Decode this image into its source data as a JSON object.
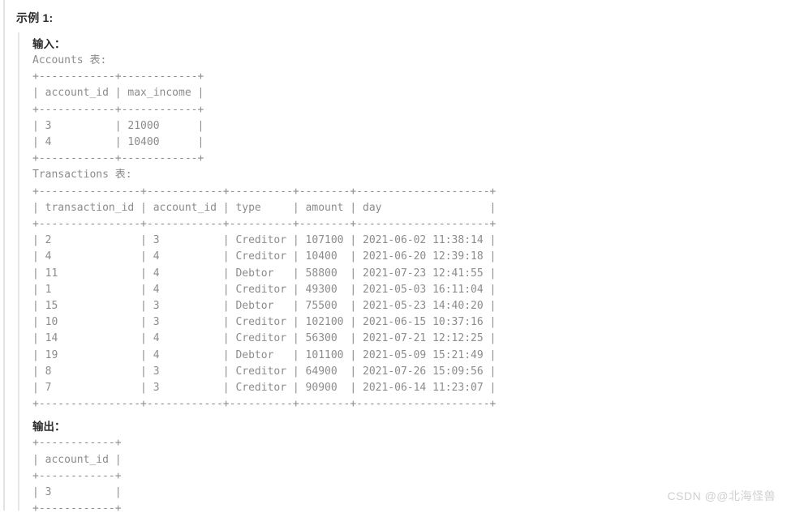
{
  "example": {
    "heading": "示例 1:"
  },
  "input": {
    "label": "输入：",
    "accounts_caption": "Accounts 表:",
    "accounts_table": "+------------+------------+\n| account_id | max_income |\n+------------+------------+\n| 3          | 21000      |\n| 4          | 10400      |\n+------------+------------+",
    "transactions_caption": "Transactions 表:",
    "transactions_table": "+----------------+------------+----------+--------+---------------------+\n| transaction_id | account_id | type     | amount | day                 |\n+----------------+------------+----------+--------+---------------------+\n| 2              | 3          | Creditor | 107100 | 2021-06-02 11:38:14 |\n| 4              | 4          | Creditor | 10400  | 2021-06-20 12:39:18 |\n| 11             | 4          | Debtor   | 58800  | 2021-07-23 12:41:55 |\n| 1              | 4          | Creditor | 49300  | 2021-05-03 16:11:04 |\n| 15             | 3          | Debtor   | 75500  | 2021-05-23 14:40:20 |\n| 10             | 3          | Creditor | 102100 | 2021-06-15 10:37:16 |\n| 14             | 4          | Creditor | 56300  | 2021-07-21 12:12:25 |\n| 19             | 4          | Debtor   | 101100 | 2021-05-09 15:21:49 |\n| 8              | 3          | Creditor | 64900  | 2021-07-26 15:09:56 |\n| 7              | 3          | Creditor | 90900  | 2021-06-14 11:23:07 |\n+----------------+------------+----------+--------+---------------------+"
  },
  "output": {
    "label": "输出：",
    "table": "+------------+\n| account_id |\n+------------+\n| 3          |\n+------------+"
  },
  "watermark": {
    "text": "CSDN @@北海怪兽"
  },
  "tables": {
    "accounts": {
      "columns": [
        "account_id",
        "max_income"
      ],
      "rows": [
        [
          "3",
          "21000"
        ],
        [
          "4",
          "10400"
        ]
      ]
    },
    "transactions": {
      "columns": [
        "transaction_id",
        "account_id",
        "type",
        "amount",
        "day"
      ],
      "rows": [
        [
          "2",
          "3",
          "Creditor",
          "107100",
          "2021-06-02 11:38:14"
        ],
        [
          "4",
          "4",
          "Creditor",
          "10400",
          "2021-06-20 12:39:18"
        ],
        [
          "11",
          "4",
          "Debtor",
          "58800",
          "2021-07-23 12:41:55"
        ],
        [
          "1",
          "4",
          "Creditor",
          "49300",
          "2021-05-03 16:11:04"
        ],
        [
          "15",
          "3",
          "Debtor",
          "75500",
          "2021-05-23 14:40:20"
        ],
        [
          "10",
          "3",
          "Creditor",
          "102100",
          "2021-06-15 10:37:16"
        ],
        [
          "14",
          "4",
          "Creditor",
          "56300",
          "2021-07-21 12:12:25"
        ],
        [
          "19",
          "4",
          "Debtor",
          "101100",
          "2021-05-09 15:21:49"
        ],
        [
          "8",
          "3",
          "Creditor",
          "64900",
          "2021-07-26 15:09:56"
        ],
        [
          "7",
          "3",
          "Creditor",
          "90900",
          "2021-06-14 11:23:07"
        ]
      ]
    },
    "result": {
      "columns": [
        "account_id"
      ],
      "rows": [
        [
          "3"
        ]
      ]
    }
  },
  "colors": {
    "page_background": "#ffffff",
    "rail": "#e3e3e3",
    "quote_rail": "#e6e6e6",
    "heading_text": "#2b2b2b",
    "code_text": "#8c8c8c",
    "watermark_text": "#d0d0d0"
  }
}
